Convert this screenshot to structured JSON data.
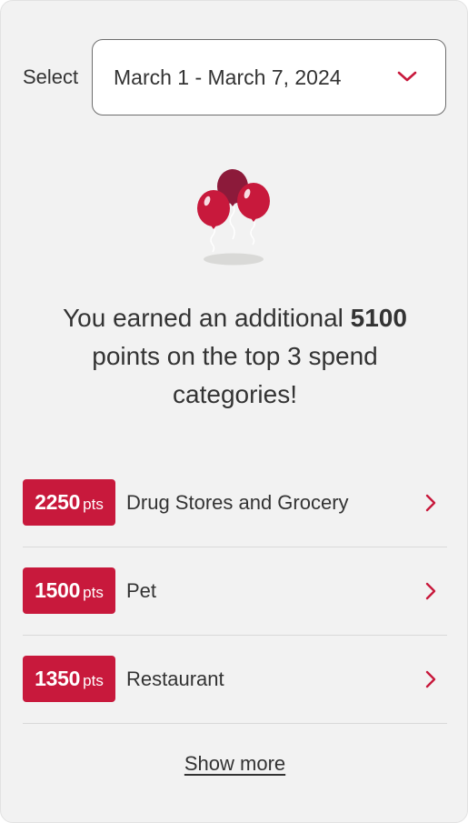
{
  "select": {
    "label": "Select",
    "value": "March 1 - March 7, 2024"
  },
  "headline": {
    "before": "You earned an additional ",
    "points": "5100",
    "after": " points on the top 3 spend categories!"
  },
  "categories": [
    {
      "points": "2250",
      "unit": "pts",
      "label": "Drug Stores and Grocery"
    },
    {
      "points": "1500",
      "unit": "pts",
      "label": "Pet"
    },
    {
      "points": "1350",
      "unit": "pts",
      "label": "Restaurant"
    }
  ],
  "show_more_label": "Show more",
  "colors": {
    "accent": "#c8193c",
    "background": "#f2f2f2",
    "text": "#333333"
  },
  "icons": {
    "dropdown": "chevron-down-icon",
    "row": "chevron-right-icon",
    "illustration": "balloons-icon"
  }
}
